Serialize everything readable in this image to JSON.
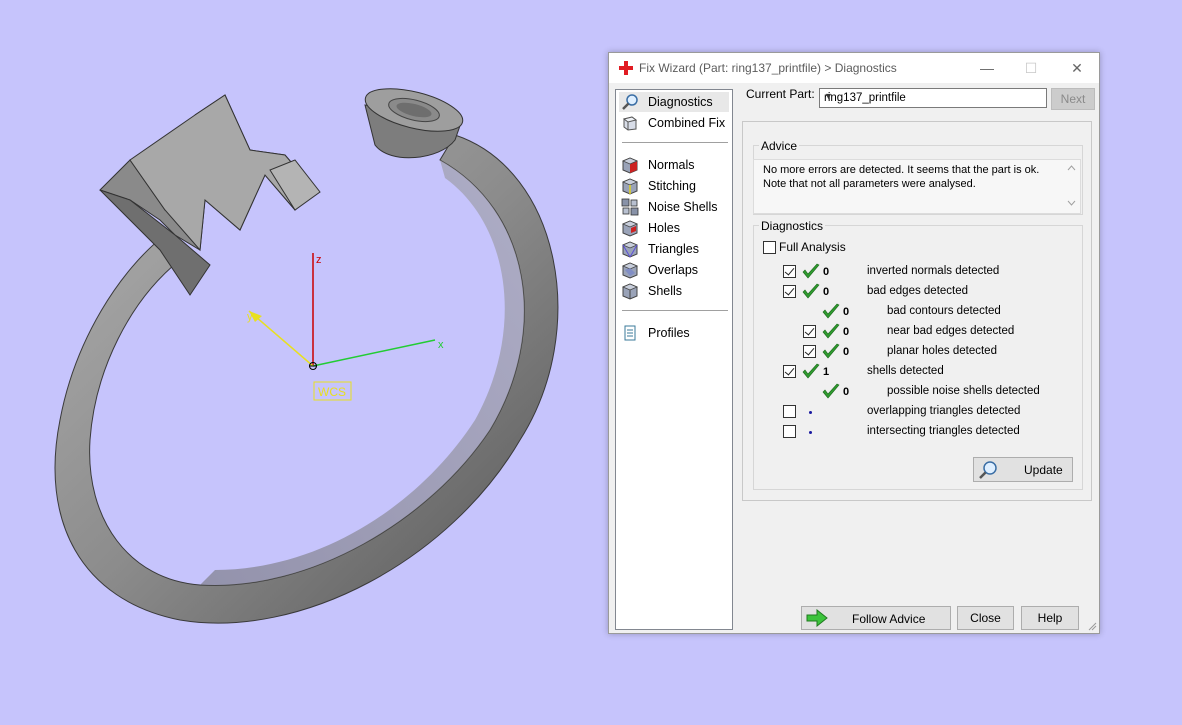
{
  "viewport": {
    "axis_labels": {
      "x": "x",
      "y": "y",
      "z": "z"
    },
    "wcs_label": "WCS",
    "colors": {
      "background": "#c6c4fc",
      "x_axis": "#22cc33",
      "y_axis": "#e8e020",
      "z_axis": "#cc0000"
    }
  },
  "dialog": {
    "title": "Fix Wizard (Part: ring137_printfile) > Diagnostics",
    "window_buttons": {
      "minimize": "—",
      "maximize": "☐",
      "close": "✕"
    },
    "nav": {
      "group1": [
        {
          "label": "Diagnostics",
          "icon": "magnifier-icon",
          "selected": true
        },
        {
          "label": "Combined Fix",
          "icon": "cube-icon"
        }
      ],
      "group2": [
        {
          "label": "Normals",
          "icon": "normals-cube-icon"
        },
        {
          "label": "Stitching",
          "icon": "stitching-cube-icon"
        },
        {
          "label": "Noise Shells",
          "icon": "noise-shells-icon"
        },
        {
          "label": "Holes",
          "icon": "holes-cube-icon"
        },
        {
          "label": "Triangles",
          "icon": "triangles-cube-icon"
        },
        {
          "label": "Overlaps",
          "icon": "overlaps-cube-icon"
        },
        {
          "label": "Shells",
          "icon": "shells-cube-icon"
        }
      ],
      "group3": [
        {
          "label": "Profiles",
          "icon": "document-icon"
        }
      ]
    },
    "current_part_label": "Current Part:",
    "current_part_value": "ring137_printfile",
    "next_label": "Next",
    "advice": {
      "title": "Advice",
      "text": "No more errors are detected. It seems that the part is ok. Note that not all parameters were analysed."
    },
    "diagnostics": {
      "title": "Diagnostics",
      "full_analysis_label": "Full Analysis",
      "full_analysis_checked": false,
      "rows": [
        {
          "checkbox": true,
          "checked": true,
          "status": "ok",
          "count": "0",
          "label": "inverted normals detected",
          "indent": 0
        },
        {
          "checkbox": true,
          "checked": true,
          "status": "ok",
          "count": "0",
          "label": "bad edges detected",
          "indent": 0
        },
        {
          "checkbox": false,
          "checked": false,
          "status": "ok",
          "count": "0",
          "label": "bad contours detected",
          "indent": 1
        },
        {
          "checkbox": true,
          "checked": true,
          "status": "ok",
          "count": "0",
          "label": "near bad edges detected",
          "indent": 1
        },
        {
          "checkbox": true,
          "checked": true,
          "status": "ok",
          "count": "0",
          "label": "planar holes detected",
          "indent": 1
        },
        {
          "checkbox": true,
          "checked": true,
          "status": "ok",
          "count": "1",
          "label": "shells detected",
          "indent": 0
        },
        {
          "checkbox": false,
          "checked": false,
          "status": "ok",
          "count": "0",
          "label": "possible noise shells detected",
          "indent": 1
        },
        {
          "checkbox": true,
          "checked": false,
          "status": "pending",
          "count": "",
          "label": "overlapping triangles detected",
          "indent": 0
        },
        {
          "checkbox": true,
          "checked": false,
          "status": "pending",
          "count": "",
          "label": "intersecting triangles detected",
          "indent": 0
        }
      ],
      "update_label": "Update"
    },
    "follow_advice_label": "Follow Advice",
    "close_label": "Close",
    "help_label": "Help"
  }
}
